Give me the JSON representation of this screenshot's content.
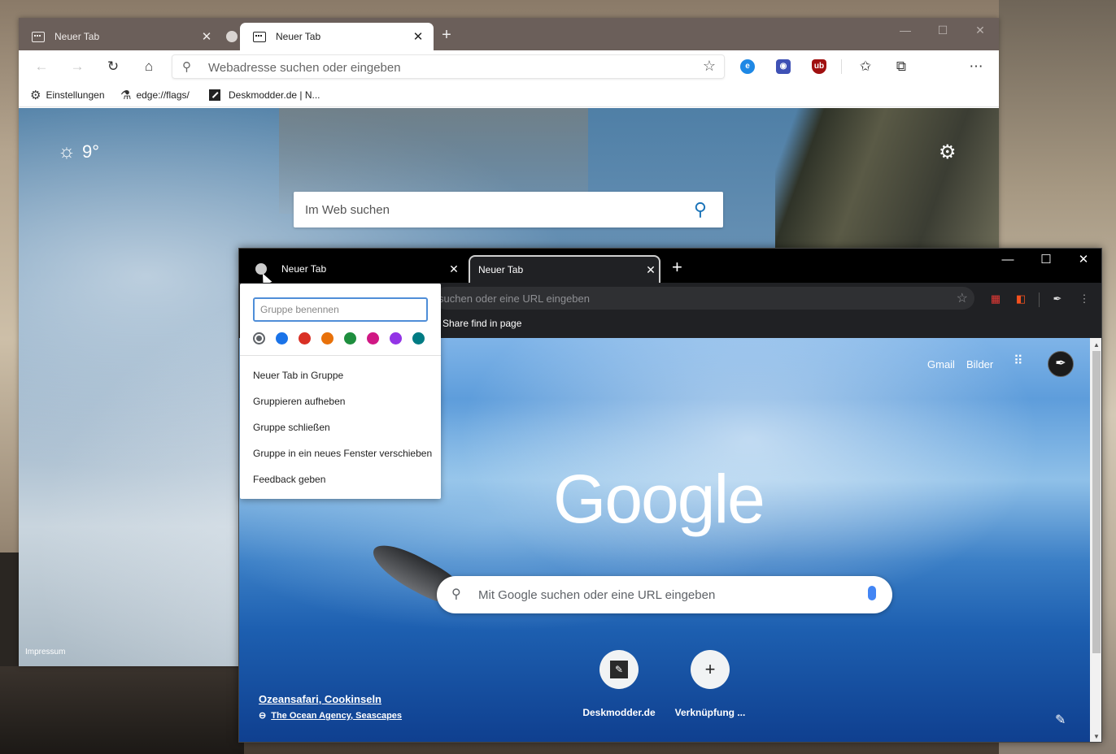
{
  "edge": {
    "tabs": [
      {
        "title": "Neuer Tab"
      },
      {
        "title": "Neuer Tab"
      }
    ],
    "address_placeholder": "Webadresse suchen oder eingeben",
    "bookmarks": [
      {
        "label": "Einstellungen"
      },
      {
        "label": "edge://flags/"
      },
      {
        "label": "Deskmodder.de | N..."
      }
    ],
    "weather": {
      "temp": "9°"
    },
    "search_placeholder": "Im Web suchen",
    "footer": "Impressum",
    "extensions": [
      {
        "name": "e",
        "color": "#1e88e5"
      },
      {
        "name": "",
        "color": "#3f51b5"
      },
      {
        "name": "ub",
        "color": "#a01010"
      }
    ]
  },
  "chrome": {
    "tabs": [
      {
        "title": "Neuer Tab"
      },
      {
        "title": "Neuer Tab"
      }
    ],
    "address_placeholder": "suchen oder eine URL eingeben",
    "bookmark": "Share find in page",
    "links": {
      "gmail": "Gmail",
      "bilder": "Bilder"
    },
    "logo": "Google",
    "search_placeholder": "Mit Google suchen oder eine URL eingeben",
    "shortcuts": [
      {
        "label": "Deskmodder.de"
      },
      {
        "label": "Verknüpfung ..."
      }
    ],
    "credit": {
      "title": "Ozeansafari, Cookinseln",
      "author": "The Ocean Agency, Seascapes"
    }
  },
  "group_menu": {
    "name_placeholder": "Gruppe benennen",
    "colors": [
      "#5f6368",
      "#1a73e8",
      "#d93025",
      "#e8710a",
      "#1e8e3e",
      "#d01884",
      "#9334e6",
      "#007b83"
    ],
    "items": [
      {
        "label": "Neuer Tab in Gruppe"
      },
      {
        "label": "Gruppieren aufheben"
      },
      {
        "label": "Gruppe schließen"
      },
      {
        "label": "Gruppe in ein neues Fenster verschieben"
      },
      {
        "label": "Feedback geben"
      }
    ]
  }
}
